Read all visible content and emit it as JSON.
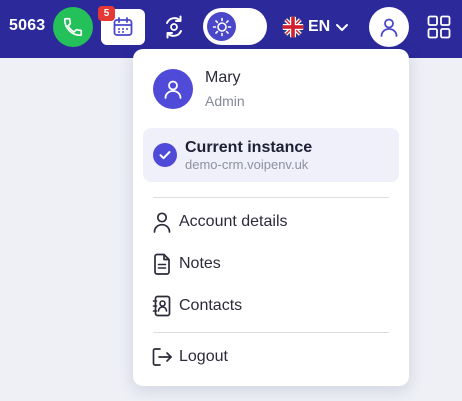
{
  "header": {
    "extension": "5063",
    "calendar_badge": "5",
    "language": "EN",
    "colors": {
      "bar": "#2c2a9b",
      "call": "#24c05a",
      "accent": "#4f4ad8",
      "badge": "#e53935"
    }
  },
  "icons": {
    "phone": "phone-icon",
    "calendar": "calendar-icon",
    "sync": "sync-icon",
    "theme": "sun-icon",
    "flag": "uk-flag-icon",
    "chevron": "chevron-down-icon",
    "user": "user-icon",
    "apps": "grid-icon"
  },
  "user_menu": {
    "name": "Mary",
    "role": "Admin",
    "instance": {
      "title": "Current instance",
      "host": "demo-crm.voipenv.uk"
    },
    "items": [
      {
        "label": "Account details",
        "icon": "person-icon"
      },
      {
        "label": "Notes",
        "icon": "document-icon"
      },
      {
        "label": "Contacts",
        "icon": "contacts-book-icon"
      }
    ],
    "logout": {
      "label": "Logout",
      "icon": "logout-icon"
    }
  }
}
